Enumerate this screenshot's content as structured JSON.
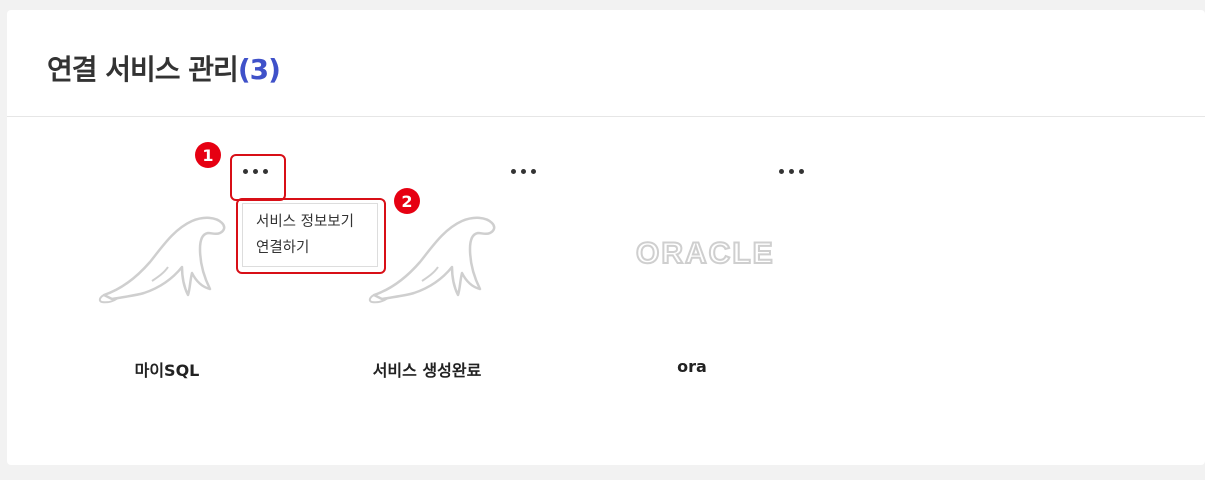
{
  "header": {
    "title": "연결 서비스 관리",
    "count": "(3)"
  },
  "services": [
    {
      "name": "마이SQL",
      "logo": "mysql-dolphin-logo"
    },
    {
      "name": "서비스 생성완료",
      "logo": "mysql-dolphin-logo"
    },
    {
      "name": "ora",
      "logo": "oracle-logo"
    }
  ],
  "logo_texts": {
    "oracle": "ORACLE"
  },
  "more_menu": {
    "items": [
      "서비스 정보보기",
      "연결하기"
    ]
  },
  "annotations": {
    "badge_1": "1",
    "badge_2": "2"
  },
  "colors": {
    "accent": "#3f51c9",
    "highlight": "#d80f17",
    "badge": "#e60012",
    "logo_gray": "#cfcfcf"
  }
}
